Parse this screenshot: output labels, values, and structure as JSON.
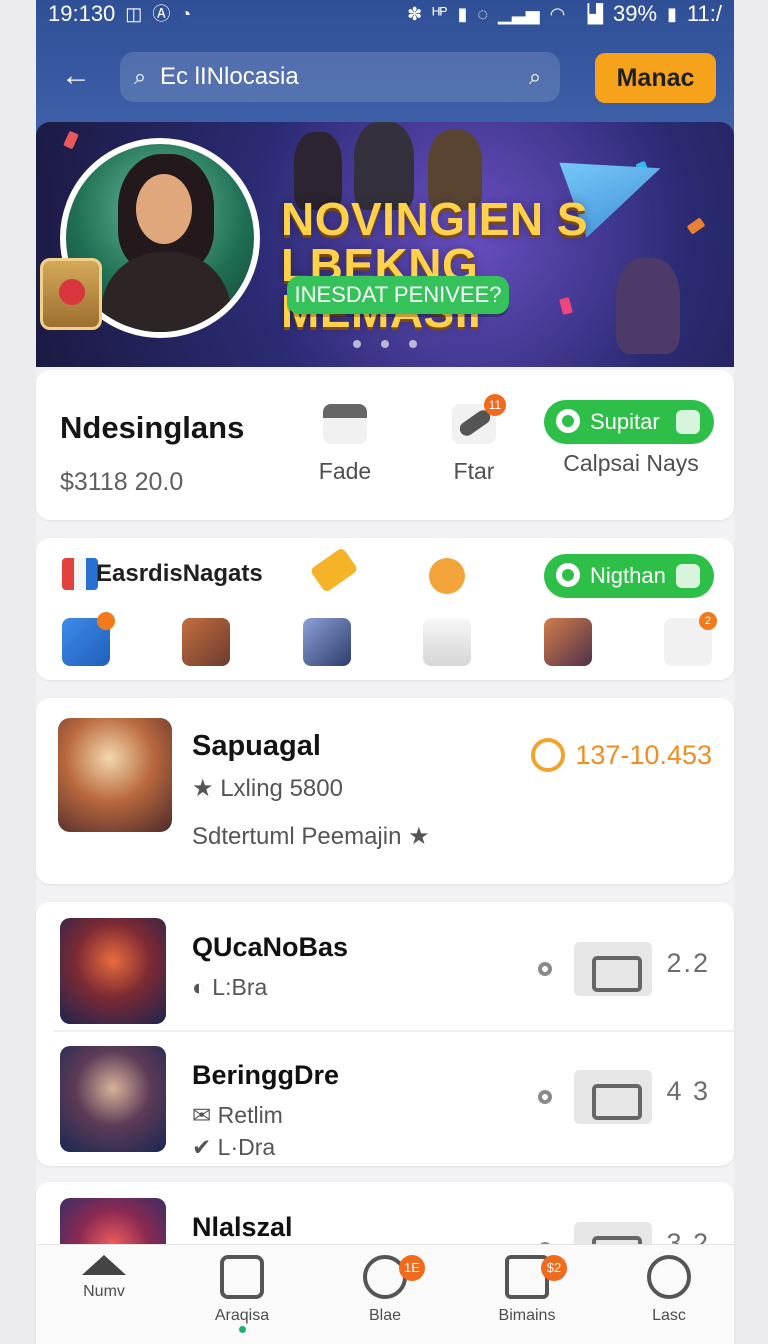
{
  "status": {
    "time": "19:130",
    "right": "39%",
    "battery": "11:/"
  },
  "topbar": {
    "search_placeholder": "Ec lINlocasia",
    "button": "Manac"
  },
  "banner": {
    "headline1": "NOVINGIEN S",
    "headline2": "LBEKNG MEMASII",
    "cta": "INESDAT PENIVEE?"
  },
  "stats": {
    "title": "Ndesinglans",
    "value": "$3118 20.0",
    "items": [
      "Fade",
      "Ftar",
      "Calpsai Nays"
    ],
    "badge": "Supitar",
    "counter": "11"
  },
  "categories": {
    "title": "EasrdisNagats",
    "pill": "Nigthan",
    "small_badge": "2"
  },
  "featured": {
    "title": "Sapuagal",
    "subtitle": "Lxling 5800",
    "desc": "Sdtertuml Peemajin",
    "value": "137-10.453"
  },
  "list": [
    {
      "title": "QUcaNoBas",
      "meta": "L:Bra",
      "value": "2.2"
    },
    {
      "title": "BeringgDre",
      "meta": "Retlim",
      "meta2": "L·Dra",
      "value": "4 3"
    },
    {
      "title": "Nlalszal",
      "value": "3.2"
    }
  ],
  "nav": [
    "Numv",
    "Araqisa",
    "Blae",
    "Bimains",
    "Lasc"
  ],
  "nav_badges": {
    "third": "1E",
    "fourth": "$2"
  }
}
